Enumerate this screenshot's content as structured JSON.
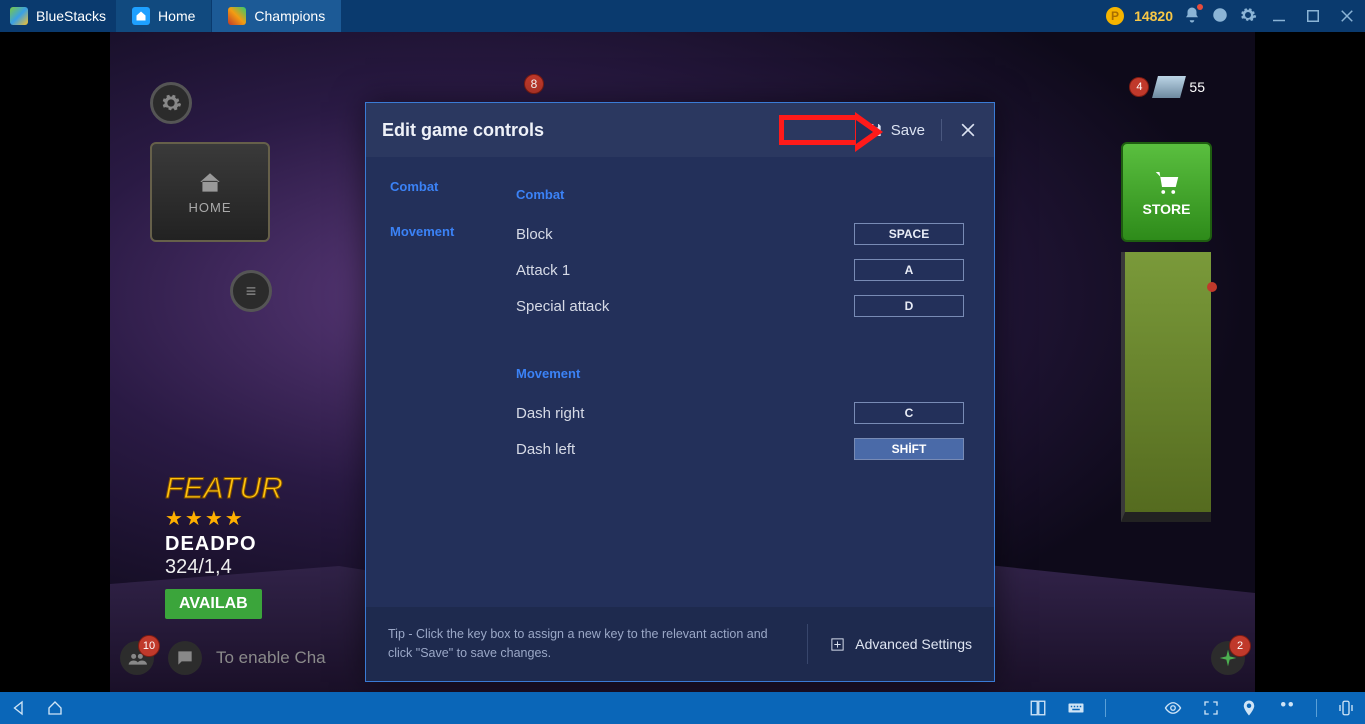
{
  "titlebar": {
    "brand": "BlueStacks",
    "tabs": [
      {
        "label": "Home",
        "icon": "home-app-icon"
      },
      {
        "label": "Champions",
        "icon": "champions-app-icon"
      }
    ],
    "coins": "14820"
  },
  "game_hud": {
    "badge_top": "8",
    "crystal_badge": "4",
    "crystal_count": "55",
    "home_btn": "HOME",
    "store_btn": "STORE",
    "featured_label": "FEATUR",
    "featured_stars": "★★★★",
    "featured_hero": "DEADPO",
    "featured_stat": "324/1,4",
    "featured_avail": "AVAILAB",
    "chat_badge_left": "10",
    "chat_badge_right": "2",
    "chat_text": "To enable Cha"
  },
  "modal": {
    "title": "Edit game controls",
    "save": "Save",
    "sidebar": {
      "combat": "Combat",
      "movement": "Movement"
    },
    "sections": {
      "combat_title": "Combat",
      "movement_title": "Movement",
      "rows": {
        "block": {
          "label": "Block",
          "key": "SPACE"
        },
        "attack1": {
          "label": "Attack 1",
          "key": "A"
        },
        "special": {
          "label": "Special attack",
          "key": "D"
        },
        "dashr": {
          "label": "Dash right",
          "key": "C"
        },
        "dashl": {
          "label": "Dash left",
          "key": "SHİFT"
        }
      }
    },
    "tip": "Tip - Click the key box to assign a new key to the relevant action and click \"Save\" to save changes.",
    "advanced": "Advanced Settings"
  }
}
